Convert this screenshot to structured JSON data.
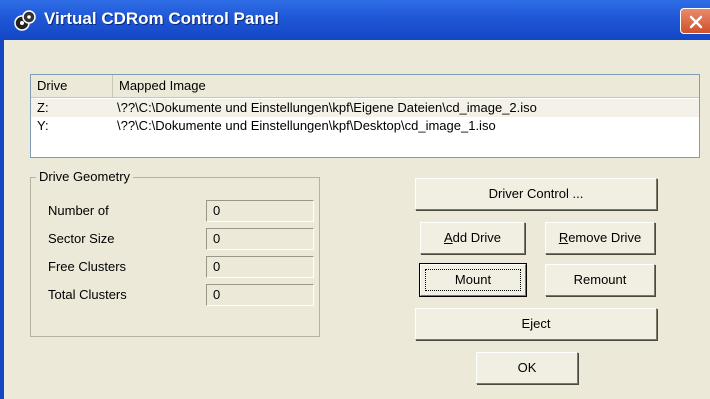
{
  "window": {
    "title": "Virtual CDRom Control Panel"
  },
  "list": {
    "columns": [
      "Drive",
      "Mapped Image"
    ],
    "rows": [
      {
        "drive": "Z:",
        "image": "\\??\\C:\\Dokumente und Einstellungen\\kpf\\Eigene Dateien\\cd_image_2.iso"
      },
      {
        "drive": "Y:",
        "image": "\\??\\C:\\Dokumente und Einstellungen\\kpf\\Desktop\\cd_image_1.iso"
      }
    ]
  },
  "geometry": {
    "legend": "Drive Geometry",
    "fields": [
      {
        "label": "Number of",
        "value": "0"
      },
      {
        "label": "Sector Size",
        "value": "0"
      },
      {
        "label": "Free Clusters",
        "value": "0"
      },
      {
        "label": "Total Clusters",
        "value": "0"
      }
    ]
  },
  "buttons": {
    "driver_control": "Driver Control ...",
    "add_drive_mnemonic": "A",
    "add_drive_rest": "dd Drive",
    "remove_drive_mnemonic": "R",
    "remove_drive_rest": "emove Drive",
    "mount": "Mount",
    "remount": "Remount",
    "eject": "Eject",
    "ok": "OK"
  },
  "icons": {
    "app": "cd-drive-icon",
    "close": "close-icon"
  }
}
